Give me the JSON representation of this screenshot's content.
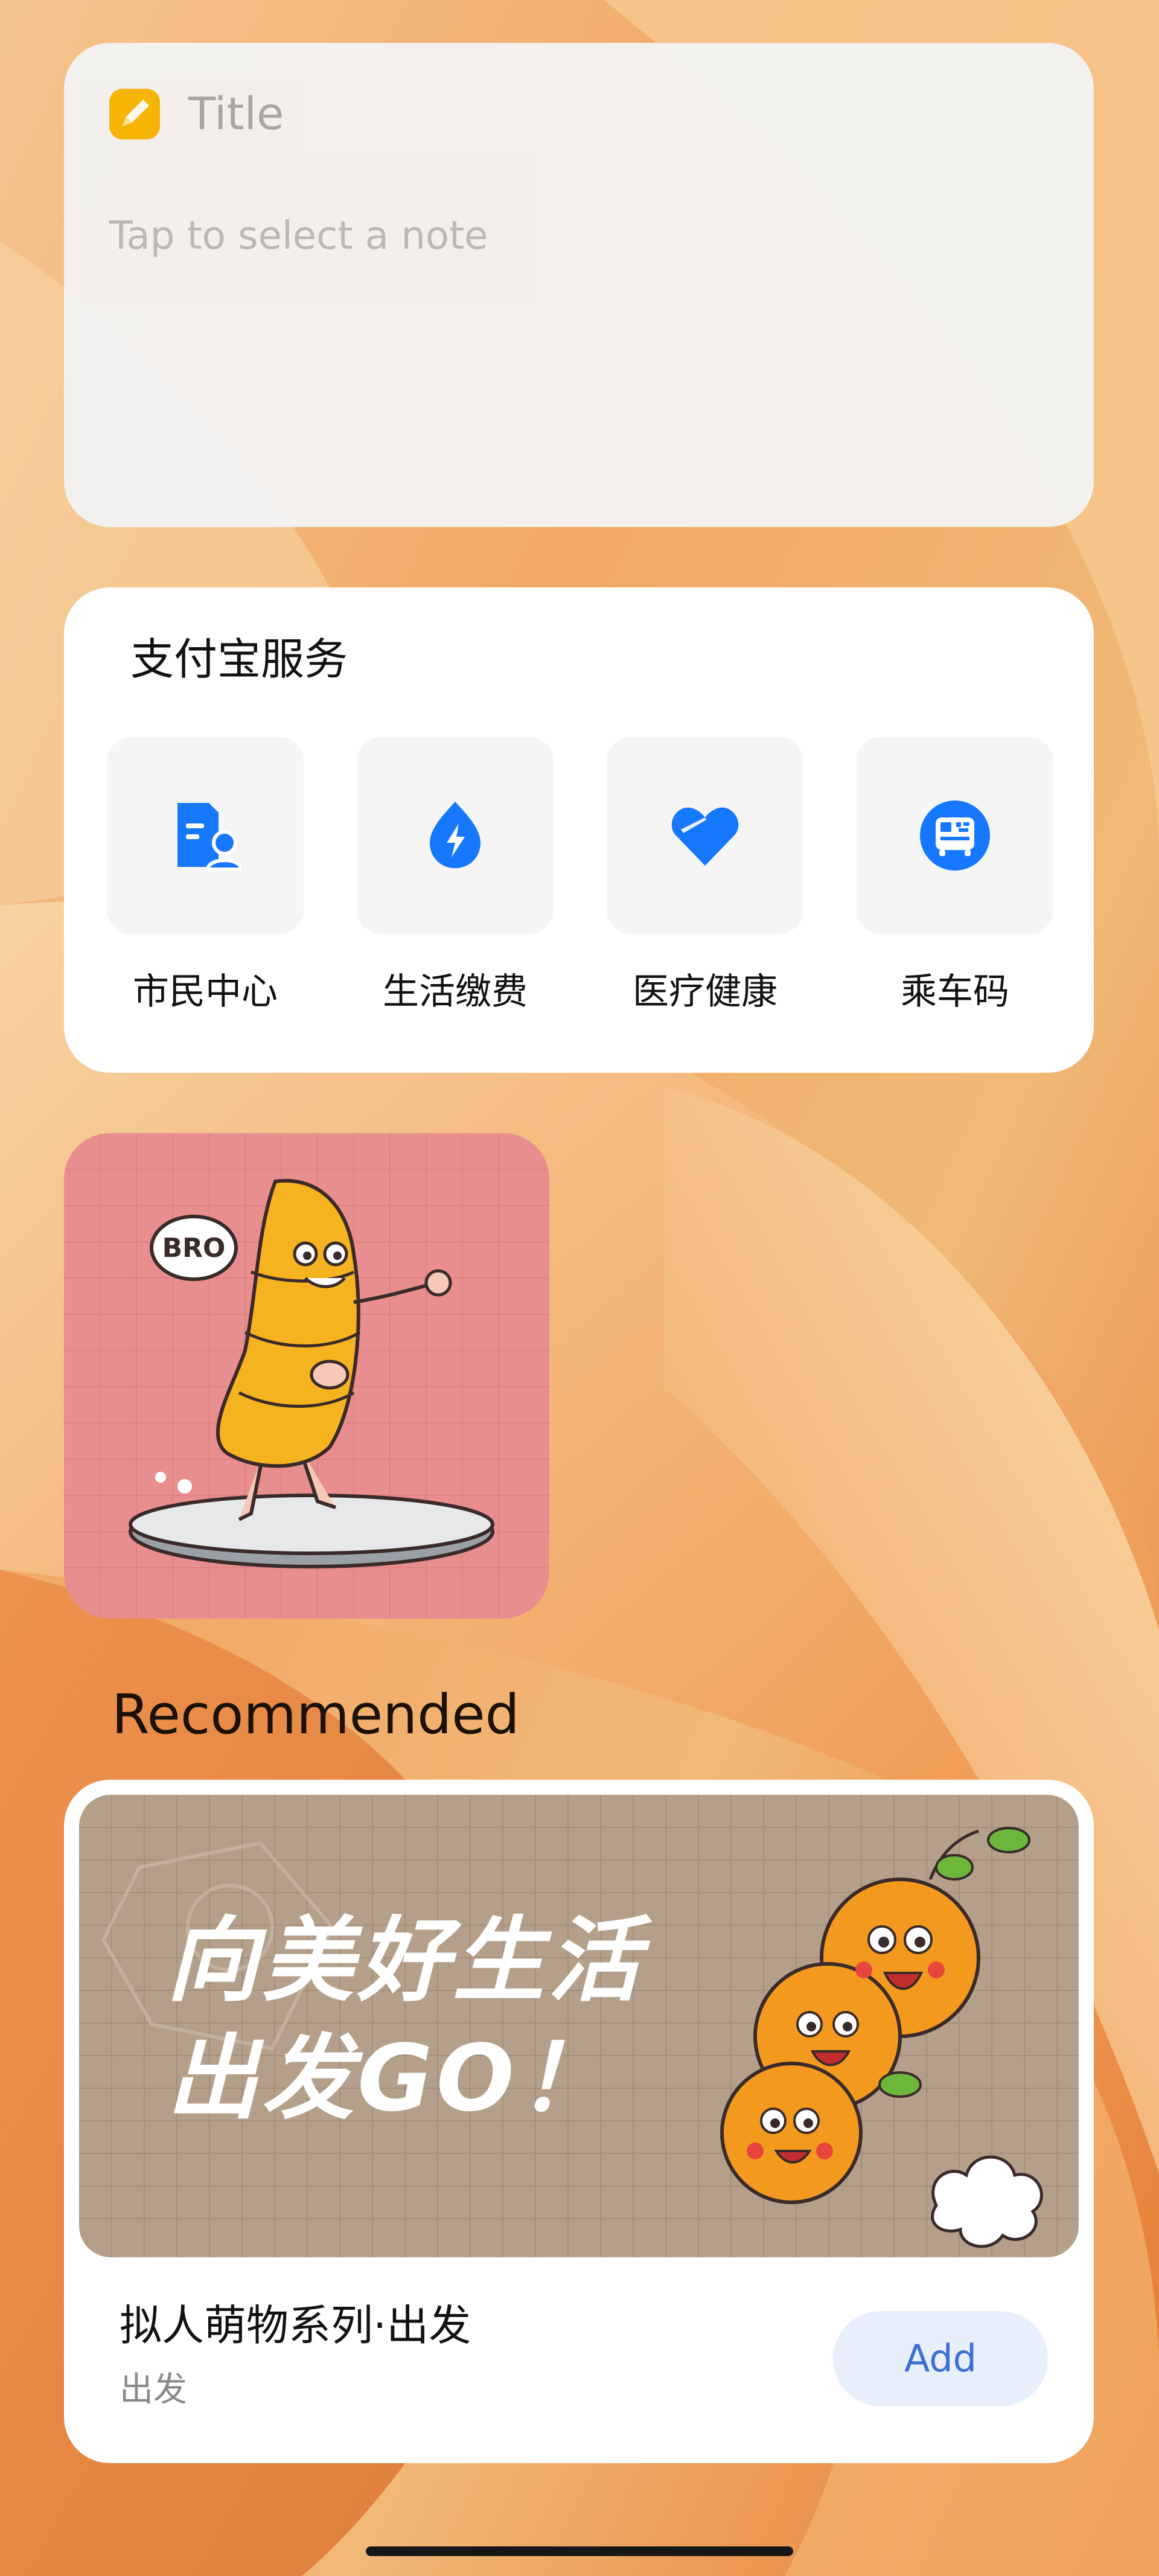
{
  "note_widget": {
    "title": "Title",
    "hint": "Tap to select a note",
    "icon": "note-pencil-icon"
  },
  "alipay_widget": {
    "title": "支付宝服务",
    "services": [
      {
        "label": "市民中心",
        "icon": "citizen-center-icon"
      },
      {
        "label": "生活缴费",
        "icon": "bill-payment-icon"
      },
      {
        "label": "医疗健康",
        "icon": "medical-health-icon"
      },
      {
        "label": "乘车码",
        "icon": "bus-qr-code-icon"
      }
    ],
    "icon_color": "#1677ff"
  },
  "photo_widget": {
    "sticker_text": "BRO",
    "background_color": "#e98e8e"
  },
  "recommended": {
    "title": "Recommended",
    "banner": {
      "line1": "向美好生活",
      "line2": "出发GO！"
    },
    "item_name": "拟人萌物系列·出发",
    "item_sub": "出发",
    "add_label": "Add"
  }
}
